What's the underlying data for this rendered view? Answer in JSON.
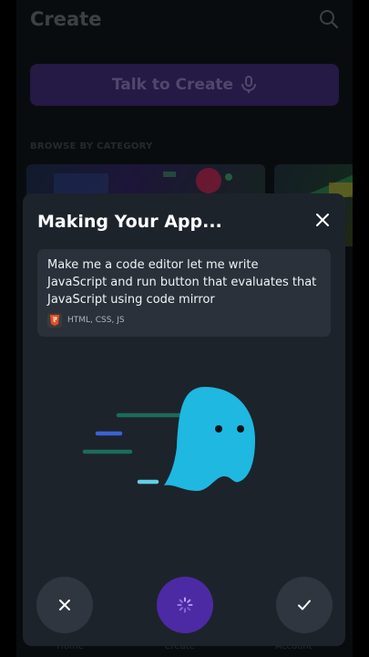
{
  "header": {
    "title": "Create"
  },
  "talk": {
    "label": "Talk to Create"
  },
  "browse": {
    "label": "BROWSE BY CATEGORY"
  },
  "nav": {
    "items": [
      "Home",
      "Create",
      "Account"
    ]
  },
  "modal": {
    "title": "Making Your App...",
    "prompt": "Make me a code editor let me write JavaScript and run button that evaluates that JavaScript using code mirror",
    "languages": "HTML, CSS, JS"
  },
  "colors": {
    "accent": "#4c2aa3",
    "ghost": "#1fb8e0",
    "sheet": "#1d232b"
  },
  "icons": {
    "search": "search-icon",
    "close": "close-icon",
    "cancel": "x-icon",
    "loading": "spinner-icon",
    "confirm": "check-icon",
    "html5": "html5-icon",
    "mascot": "ghost-icon"
  }
}
